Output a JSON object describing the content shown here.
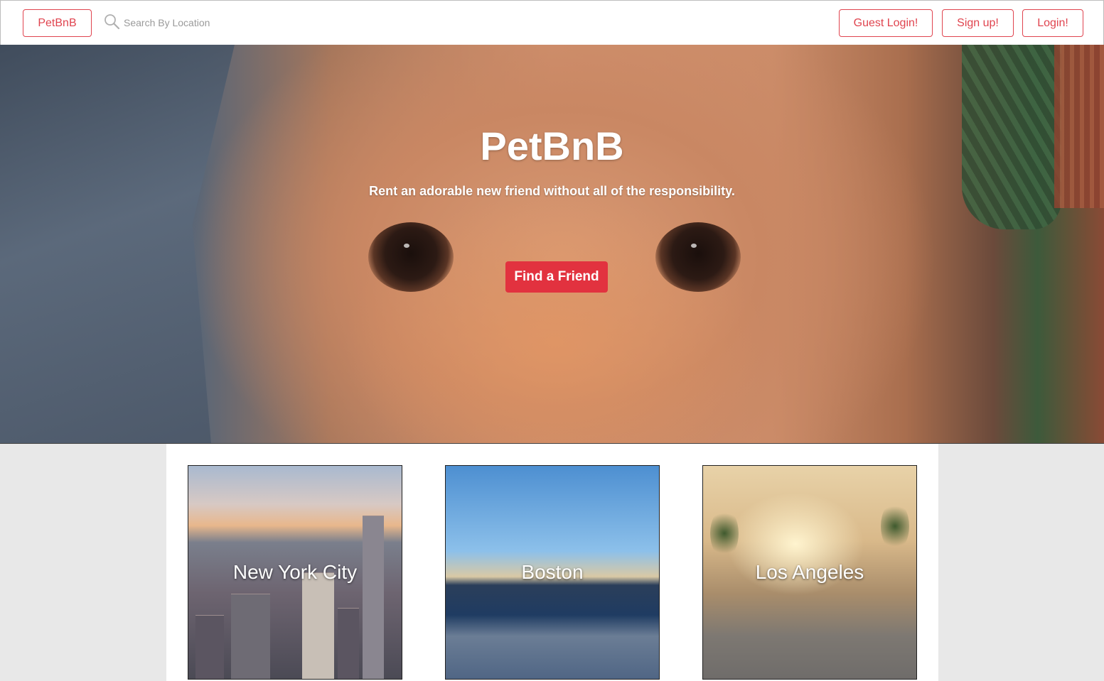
{
  "header": {
    "brand_label": "PetBnB",
    "search": {
      "placeholder": "Search By Location",
      "value": ""
    },
    "guest_login_label": "Guest Login!",
    "signup_label": "Sign up!",
    "login_label": "Login!"
  },
  "hero": {
    "title": "PetBnB",
    "subtitle": "Rent an adorable new friend without all of the responsibility.",
    "cta_label": "Find a Friend"
  },
  "cities": [
    {
      "name": "New York City"
    },
    {
      "name": "Boston"
    },
    {
      "name": "Los Angeles"
    }
  ],
  "colors": {
    "accent": "#e0444f",
    "cta_background": "#e2323f",
    "page_background": "#e8e8e8"
  }
}
